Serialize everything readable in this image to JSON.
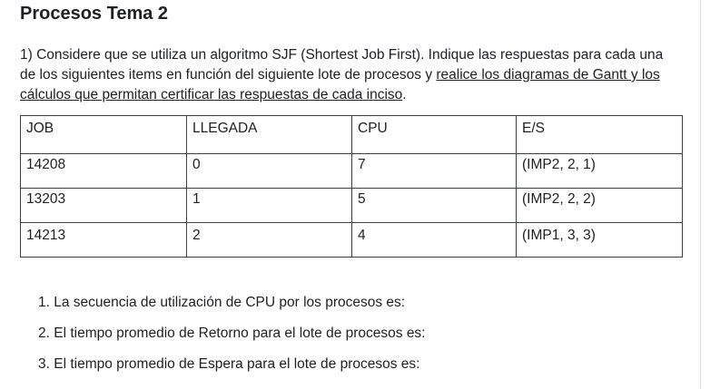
{
  "doc": {
    "title": "Procesos Tema 2",
    "question": {
      "part1": "1) Considere que se utiliza un algoritmo SJF (Shortest Job First). Indique las respuestas para cada una de los siguientes items en función del siguiente lote de procesos y ",
      "underlined": "realice los diagramas de Gantt y los cálculos que permitan certificar las respuestas de cada inciso",
      "part2": "."
    },
    "table": {
      "headers": [
        "JOB",
        "LLEGADA",
        "CPU",
        "E/S"
      ],
      "rows": [
        [
          "14208",
          "0",
          "7",
          "(IMP2, 2, 1)"
        ],
        [
          "13203",
          "1",
          "5",
          "(IMP2, 2, 2)"
        ],
        [
          "14213",
          "2",
          "4",
          "(IMP1, 3, 3)"
        ]
      ]
    },
    "items": [
      "1. La secuencia de utilización de CPU por los procesos es:",
      "2. El tiempo promedio de Retorno para el lote de procesos es:",
      "3. El tiempo promedio de Espera para el lote de procesos es:"
    ]
  }
}
